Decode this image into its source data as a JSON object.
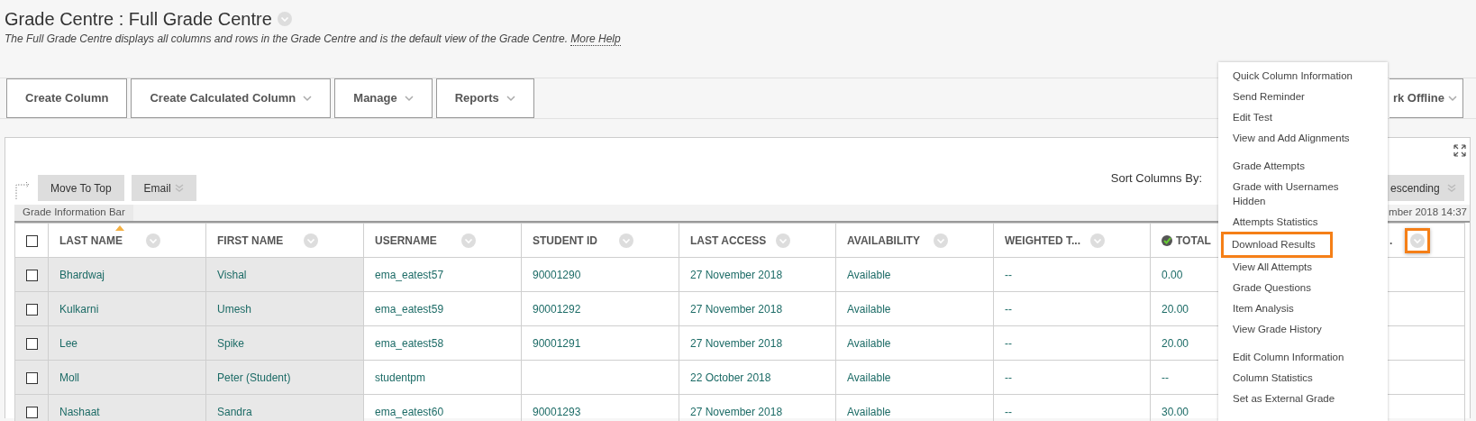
{
  "page": {
    "title": "Grade Centre : Full Grade Centre",
    "description": "The Full Grade Centre displays all columns and rows in the Grade Centre and is the default view of the Grade Centre.",
    "help_link": "More Help"
  },
  "action_bar": {
    "buttons": [
      {
        "label": "Create Column",
        "dropdown": false
      },
      {
        "label": "Create Calculated Column",
        "dropdown": true
      },
      {
        "label": "Manage",
        "dropdown": true
      },
      {
        "label": "Reports",
        "dropdown": true
      }
    ],
    "right_button": {
      "label": "rk Offline",
      "dropdown": true
    }
  },
  "toolbar": {
    "buttons": [
      {
        "label": "Move To Top",
        "dropdown": false
      },
      {
        "label": "Email",
        "dropdown": true
      }
    ],
    "sort_label": "Sort Columns By:",
    "order_select": "escending",
    "info_bar": "Grade Information Bar",
    "last_saved": "mber 2018 14:37"
  },
  "table": {
    "columns": [
      {
        "label": "LAST NAME",
        "sorted": true,
        "external_grade": false,
        "highlighted": false
      },
      {
        "label": "FIRST NAME",
        "sorted": false,
        "external_grade": false,
        "highlighted": false
      },
      {
        "label": "USERNAME",
        "sorted": false,
        "external_grade": false,
        "highlighted": false
      },
      {
        "label": "STUDENT ID",
        "sorted": false,
        "external_grade": false,
        "highlighted": false
      },
      {
        "label": "LAST ACCESS",
        "sorted": false,
        "external_grade": false,
        "highlighted": false
      },
      {
        "label": "AVAILABILITY",
        "sorted": false,
        "external_grade": false,
        "highlighted": false
      },
      {
        "label": "WEIGHTED T...",
        "sorted": false,
        "external_grade": false,
        "highlighted": false
      },
      {
        "label": "TOTAL",
        "sorted": false,
        "external_grade": true,
        "highlighted": false
      },
      {
        "label": ".",
        "sorted": false,
        "external_grade": false,
        "highlighted": true
      }
    ],
    "header_checked": false,
    "rows": [
      {
        "checked": false,
        "cells": [
          "Bhardwaj",
          "Vishal",
          "ema_eatest57",
          "90001290",
          "27 November 2018",
          "Available",
          "--",
          "0.00",
          ""
        ]
      },
      {
        "checked": false,
        "cells": [
          "Kulkarni",
          "Umesh",
          "ema_eatest59",
          "90001292",
          "27 November 2018",
          "Available",
          "--",
          "20.00",
          ""
        ]
      },
      {
        "checked": false,
        "cells": [
          "Lee",
          "Spike",
          "ema_eatest58",
          "90001291",
          "27 November 2018",
          "Available",
          "--",
          "20.00",
          ""
        ]
      },
      {
        "checked": false,
        "cells": [
          "Moll",
          "Peter (Student)",
          "studentpm",
          "",
          "22 October 2018",
          "Available",
          "--",
          "--",
          ""
        ]
      },
      {
        "checked": false,
        "cells": [
          "Nashaat",
          "Sandra",
          "ema_eatest60",
          "90001293",
          "27 November 2018",
          "Available",
          "--",
          "30.00",
          ""
        ]
      }
    ]
  },
  "context_menu": {
    "groups": [
      [
        {
          "label": "Quick Column Information",
          "highlighted": false
        },
        {
          "label": "Send Reminder",
          "highlighted": false
        },
        {
          "label": "Edit Test",
          "highlighted": false
        },
        {
          "label": "View and Add Alignments",
          "highlighted": false
        }
      ],
      [
        {
          "label": "Grade Attempts",
          "highlighted": false
        },
        {
          "label": "Grade with Usernames Hidden",
          "highlighted": false
        },
        {
          "label": "Attempts Statistics",
          "highlighted": false
        },
        {
          "label": "Download Results",
          "highlighted": true
        },
        {
          "label": "View All Attempts",
          "highlighted": false
        },
        {
          "label": "Grade Questions",
          "highlighted": false
        },
        {
          "label": "Item Analysis",
          "highlighted": false
        },
        {
          "label": "View Grade History",
          "highlighted": false
        }
      ],
      [
        {
          "label": "Edit Column Information",
          "highlighted": false
        },
        {
          "label": "Column Statistics",
          "highlighted": false
        },
        {
          "label": "Set as External Grade",
          "highlighted": false
        }
      ]
    ]
  }
}
